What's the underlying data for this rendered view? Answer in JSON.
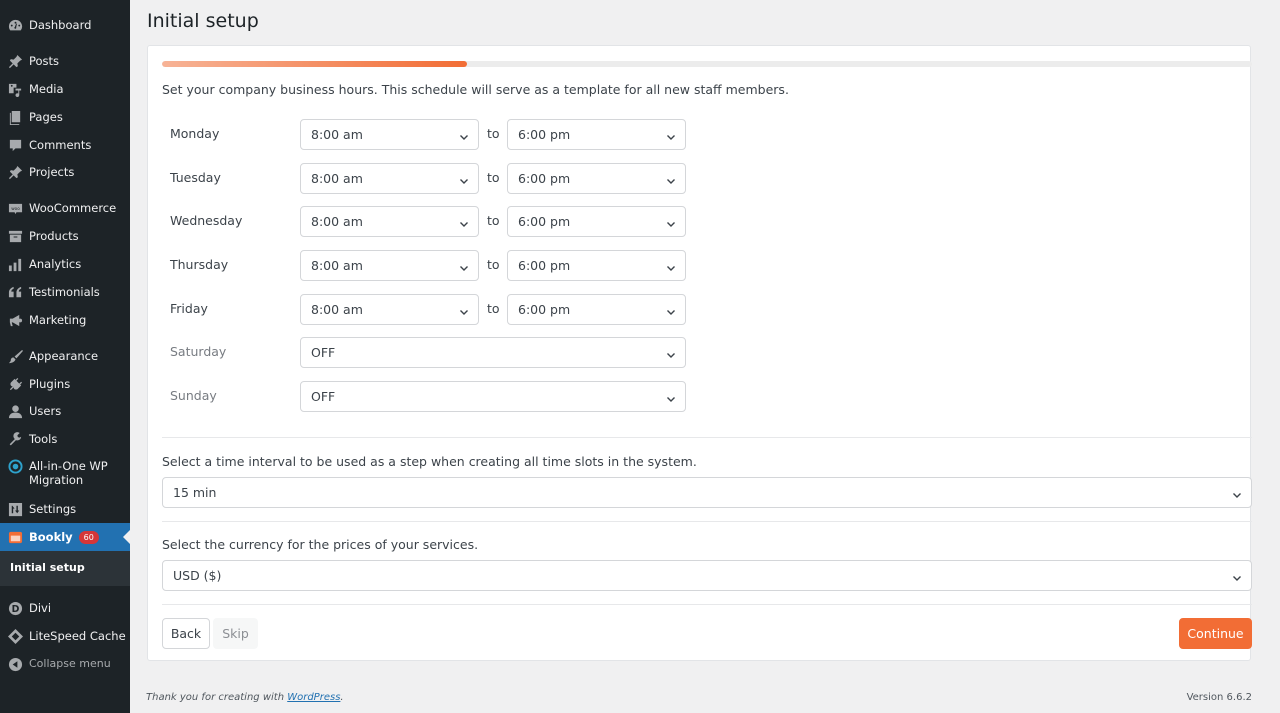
{
  "sidebar": {
    "items": [
      {
        "label": "Dashboard",
        "icon": "dashboard-icon"
      },
      {
        "label": "Posts",
        "icon": "pin-icon"
      },
      {
        "label": "Media",
        "icon": "media-icon"
      },
      {
        "label": "Pages",
        "icon": "pages-icon"
      },
      {
        "label": "Comments",
        "icon": "comment-icon"
      },
      {
        "label": "Projects",
        "icon": "pin-icon"
      },
      {
        "label": "WooCommerce",
        "icon": "woo-icon"
      },
      {
        "label": "Products",
        "icon": "archive-icon"
      },
      {
        "label": "Analytics",
        "icon": "bar-chart-icon"
      },
      {
        "label": "Testimonials",
        "icon": "quote-icon"
      },
      {
        "label": "Marketing",
        "icon": "megaphone-icon"
      },
      {
        "label": "Appearance",
        "icon": "paintbrush-icon"
      },
      {
        "label": "Plugins",
        "icon": "plug-icon"
      },
      {
        "label": "Users",
        "icon": "user-icon"
      },
      {
        "label": "Tools",
        "icon": "wrench-icon"
      },
      {
        "label": "All-in-One WP Migration",
        "icon": "migration-icon"
      },
      {
        "label": "Settings",
        "icon": "settings-icon"
      },
      {
        "label": "Bookly",
        "icon": "bookly-icon",
        "badge": "60"
      },
      {
        "label": "Divi",
        "icon": "divi-icon"
      },
      {
        "label": "LiteSpeed Cache",
        "icon": "diamond-icon"
      },
      {
        "label": "Collapse menu",
        "icon": "collapse-icon"
      }
    ],
    "submenu": {
      "label": "Initial setup"
    }
  },
  "page": {
    "title": "Initial setup",
    "progress_percent": 28,
    "intro": "Set your company business hours. This schedule will serve as a template for all new staff members.",
    "to_label": "to",
    "days": [
      {
        "name": "Monday",
        "from": "8:00 am",
        "to": "6:00 pm"
      },
      {
        "name": "Tuesday",
        "from": "8:00 am",
        "to": "6:00 pm"
      },
      {
        "name": "Wednesday",
        "from": "8:00 am",
        "to": "6:00 pm"
      },
      {
        "name": "Thursday",
        "from": "8:00 am",
        "to": "6:00 pm"
      },
      {
        "name": "Friday",
        "from": "8:00 am",
        "to": "6:00 pm"
      },
      {
        "name": "Saturday",
        "value": "OFF"
      },
      {
        "name": "Sunday",
        "value": "OFF"
      }
    ],
    "interval": {
      "label": "Select a time interval to be used as a step when creating all time slots in the system.",
      "value": "15 min"
    },
    "currency": {
      "label": "Select the currency for the prices of your services.",
      "value": "USD ($)"
    },
    "buttons": {
      "back": "Back",
      "skip": "Skip",
      "continue": "Continue"
    },
    "accent_color": "#f26d35"
  },
  "footer": {
    "thanks_prefix": "Thank you for creating with ",
    "link_text": "WordPress",
    "thanks_suffix": ".",
    "version": "Version 6.6.2"
  }
}
